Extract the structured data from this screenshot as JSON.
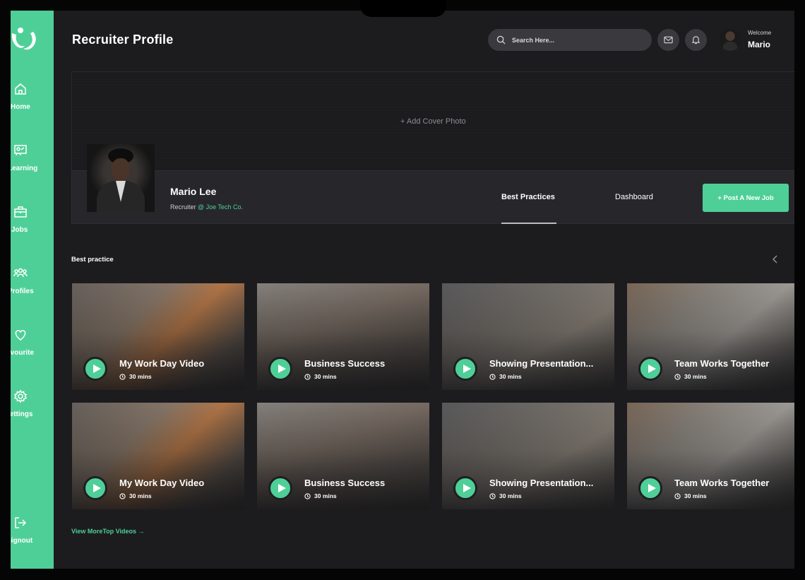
{
  "sidebar": {
    "items": [
      {
        "label": "Home",
        "icon": "home-icon"
      },
      {
        "label": "Learning",
        "icon": "learning-icon"
      },
      {
        "label": "Jobs",
        "icon": "briefcase-icon"
      },
      {
        "label": "Profiles",
        "icon": "profiles-icon"
      },
      {
        "label": "Favourite",
        "icon": "heart-icon"
      },
      {
        "label": "Settings",
        "icon": "gear-icon"
      }
    ],
    "signout_label": "Signout"
  },
  "header": {
    "title": "Recruiter Profile",
    "search_placeholder": "Search Here...",
    "welcome": "Welcome",
    "user_name": "Mario"
  },
  "cover": {
    "add_label": "+  Add Cover Photo"
  },
  "profile": {
    "name": "Mario Lee",
    "role_prefix": "Recruiter",
    "company": "@ Joe Tech Co.",
    "tabs": [
      "Best Practices",
      "Dashboard"
    ],
    "post_button": "+  Post A New Job"
  },
  "section": {
    "title": "Best practice",
    "view_more": "View MoreTop Videos  →"
  },
  "videos": [
    {
      "title": "My Work Day Video",
      "duration": "30 mins"
    },
    {
      "title": "Business Success",
      "duration": "30 mins"
    },
    {
      "title": "Showing Presentation...",
      "duration": "30 mins"
    },
    {
      "title": "Team Works Together",
      "duration": "30 mins"
    },
    {
      "title": "My Work Day Video",
      "duration": "30 mins"
    },
    {
      "title": "Business Success",
      "duration": "30 mins"
    },
    {
      "title": "Showing Presentation...",
      "duration": "30 mins"
    },
    {
      "title": "Team Works Together",
      "duration": "30 mins"
    }
  ],
  "colors": {
    "accent": "#4fcf98",
    "background": "#1c1c1f",
    "panel": "#27272b"
  }
}
